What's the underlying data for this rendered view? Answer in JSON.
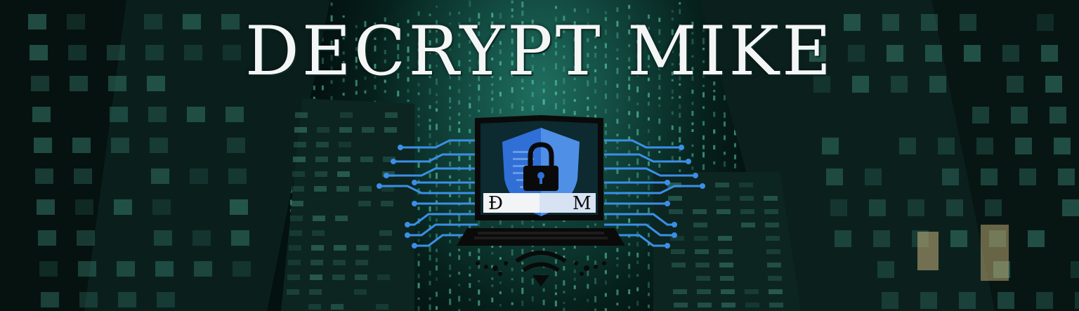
{
  "banner": {
    "title": "DECRYPT MIKE",
    "logo_initial_left": "Đ",
    "logo_initial_right": "M",
    "colors": {
      "accent_green": "#2fb89a",
      "shield_blue": "#2f6fd6",
      "circuit_blue": "#3a8fe8",
      "title_white": "#f4f6f5"
    },
    "icons": [
      "lock-icon",
      "shield-icon",
      "laptop-icon",
      "wifi-icon",
      "circuit-traces"
    ]
  }
}
